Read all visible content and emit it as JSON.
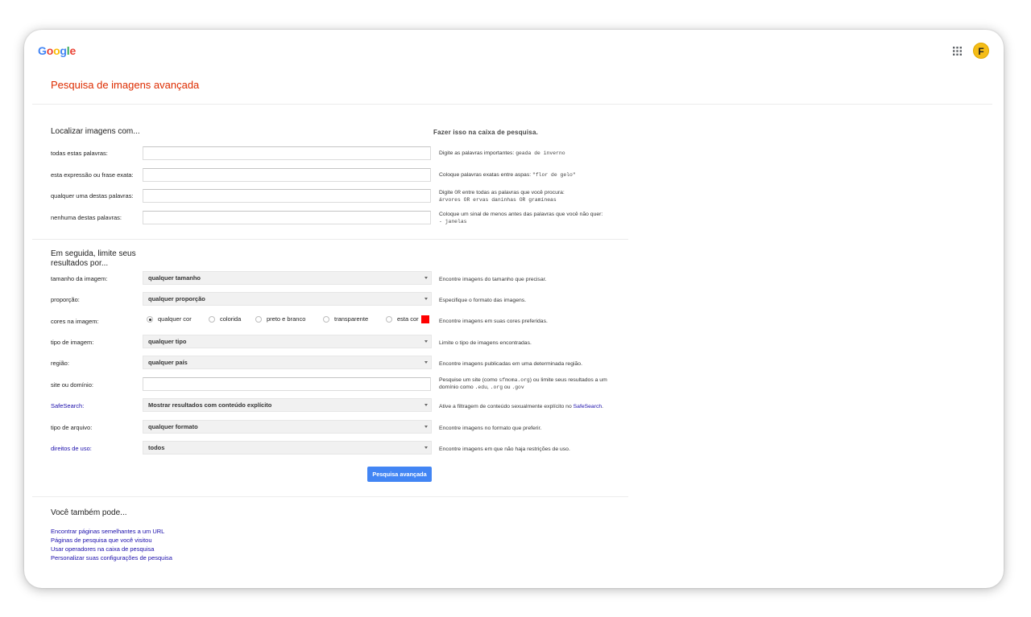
{
  "header": {
    "logo_letters": [
      {
        "ch": "G",
        "color": "#4285f4"
      },
      {
        "ch": "o",
        "color": "#ea4335"
      },
      {
        "ch": "o",
        "color": "#fbbc05"
      },
      {
        "ch": "g",
        "color": "#4285f4"
      },
      {
        "ch": "l",
        "color": "#34a853"
      },
      {
        "ch": "e",
        "color": "#ea4335"
      }
    ],
    "apps_icon": "apps-grid-icon",
    "avatar_letter": "F"
  },
  "page_title": "Pesquisa de imagens avançada",
  "find_section": {
    "heading": "Localizar imagens com...",
    "right_heading": "Fazer isso na caixa de pesquisa.",
    "rows": [
      {
        "label": "todas estas palavras:",
        "value": "",
        "hint_text": "Digite as palavras importantes: ",
        "hint_code": "geada de inverno"
      },
      {
        "label": "esta expressão ou frase exata:",
        "value": "",
        "hint_text": "Coloque palavras exatas entre aspas: ",
        "hint_code": "\"flor de gelo\""
      },
      {
        "label": "qualquer uma destas palavras:",
        "value": "",
        "hint_pre": "Digite ",
        "hint_code_or": "OR",
        "hint_post": " entre todas as palavras que você procura:",
        "hint_code2": "árvores OR ervas daninhas OR gramíneas"
      },
      {
        "label": "nenhuma destas palavras:",
        "value": "",
        "hint_text": "Coloque um sinal de menos antes das palavras que você não quer:",
        "hint_code2": "- janelas"
      }
    ]
  },
  "limit_section": {
    "heading_line1": "Em seguida, limite seus",
    "heading_line2": "resultados por...",
    "size": {
      "label": "tamanho da imagem:",
      "selected": "qualquer tamanho",
      "hint": "Encontre imagens do tamanho que precisar."
    },
    "aspect": {
      "label": "proporção:",
      "selected": "qualquer proporção",
      "hint": "Especifique o formato das imagens."
    },
    "colors": {
      "label": "cores na imagem:",
      "options": [
        "qualquer cor",
        "colorida",
        "preto e branco",
        "transparente",
        "esta cor"
      ],
      "selected_index": 0,
      "swatch_color": "#ff0000",
      "hint": "Encontre imagens em suas cores preferidas."
    },
    "type": {
      "label": "tipo de imagem:",
      "selected": "qualquer tipo",
      "hint": "Limite o tipo de imagens encontradas."
    },
    "region": {
      "label": "região:",
      "selected": "qualquer país",
      "hint": "Encontre imagens publicadas em uma determinada região."
    },
    "site": {
      "label": "site ou domínio:",
      "value": "",
      "hint_pre": "Pesquise um site (como ",
      "hint_code1": "sfmoma.org",
      "hint_mid": ") ou limite seus resultados a um",
      "hint_line2_pre": "domínio como ",
      "hint_code2": ".edu",
      "hint_sep1": ", ",
      "hint_code3": ".org",
      "hint_sep2": " ou ",
      "hint_code4": ".gov"
    },
    "safesearch": {
      "label": "SafeSearch:",
      "selected": "Mostrar resultados com conteúdo explícito",
      "hint_pre": "Ative a filtragem de conteúdo sexualmente explícito no ",
      "hint_link": "SafeSearch",
      "hint_post": "."
    },
    "filetype": {
      "label": "tipo de arquivo:",
      "selected": "qualquer formato",
      "hint": "Encontre imagens no formato que preferir."
    },
    "rights": {
      "label": "direitos de uso:",
      "selected": "todos",
      "hint": "Encontre imagens em que não haja restrições de uso."
    }
  },
  "submit_label": "Pesquisa avançada",
  "also_section": {
    "heading": "Você também pode...",
    "links": [
      "Encontrar páginas semelhantes a um URL",
      "Páginas de pesquisa que você visitou",
      "Usar operadores na caixa de pesquisa",
      "Personalizar suas configurações de pesquisa"
    ]
  }
}
